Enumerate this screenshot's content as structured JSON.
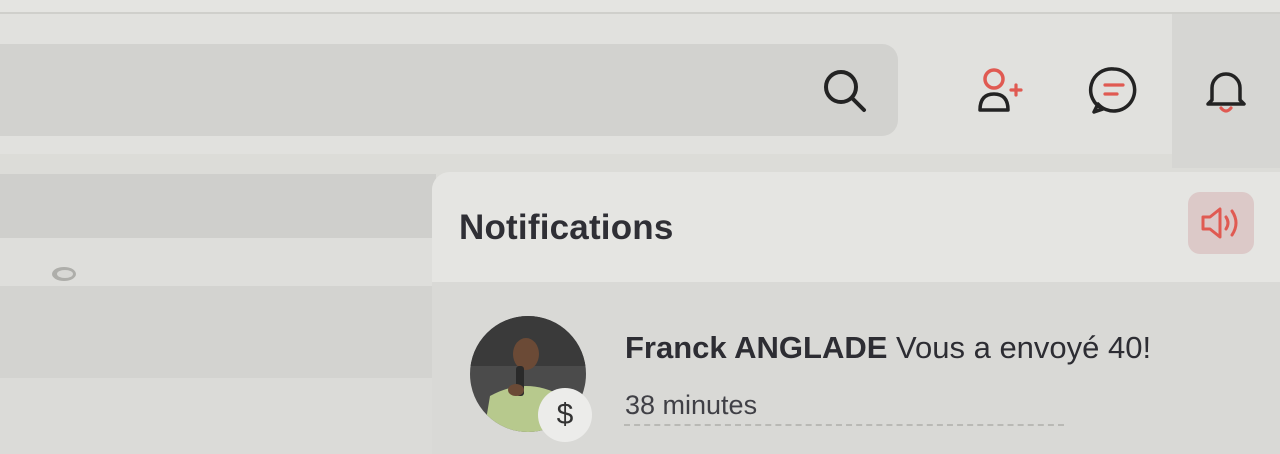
{
  "header": {
    "search_icon": "search-icon",
    "actions": [
      {
        "name": "add-user-icon",
        "color": "#e05a52"
      },
      {
        "name": "chat-icon",
        "color": "#e05a52"
      },
      {
        "name": "bell-icon",
        "color": "#e05a52"
      }
    ]
  },
  "notifications": {
    "title": "Notifications",
    "sound_icon": "speaker-icon",
    "accent": "#e05a52",
    "items": [
      {
        "sender": "Franck ANGLADE",
        "message": "Vous a envoyé 40!",
        "time": "38 minutes",
        "badge": "$"
      }
    ]
  }
}
